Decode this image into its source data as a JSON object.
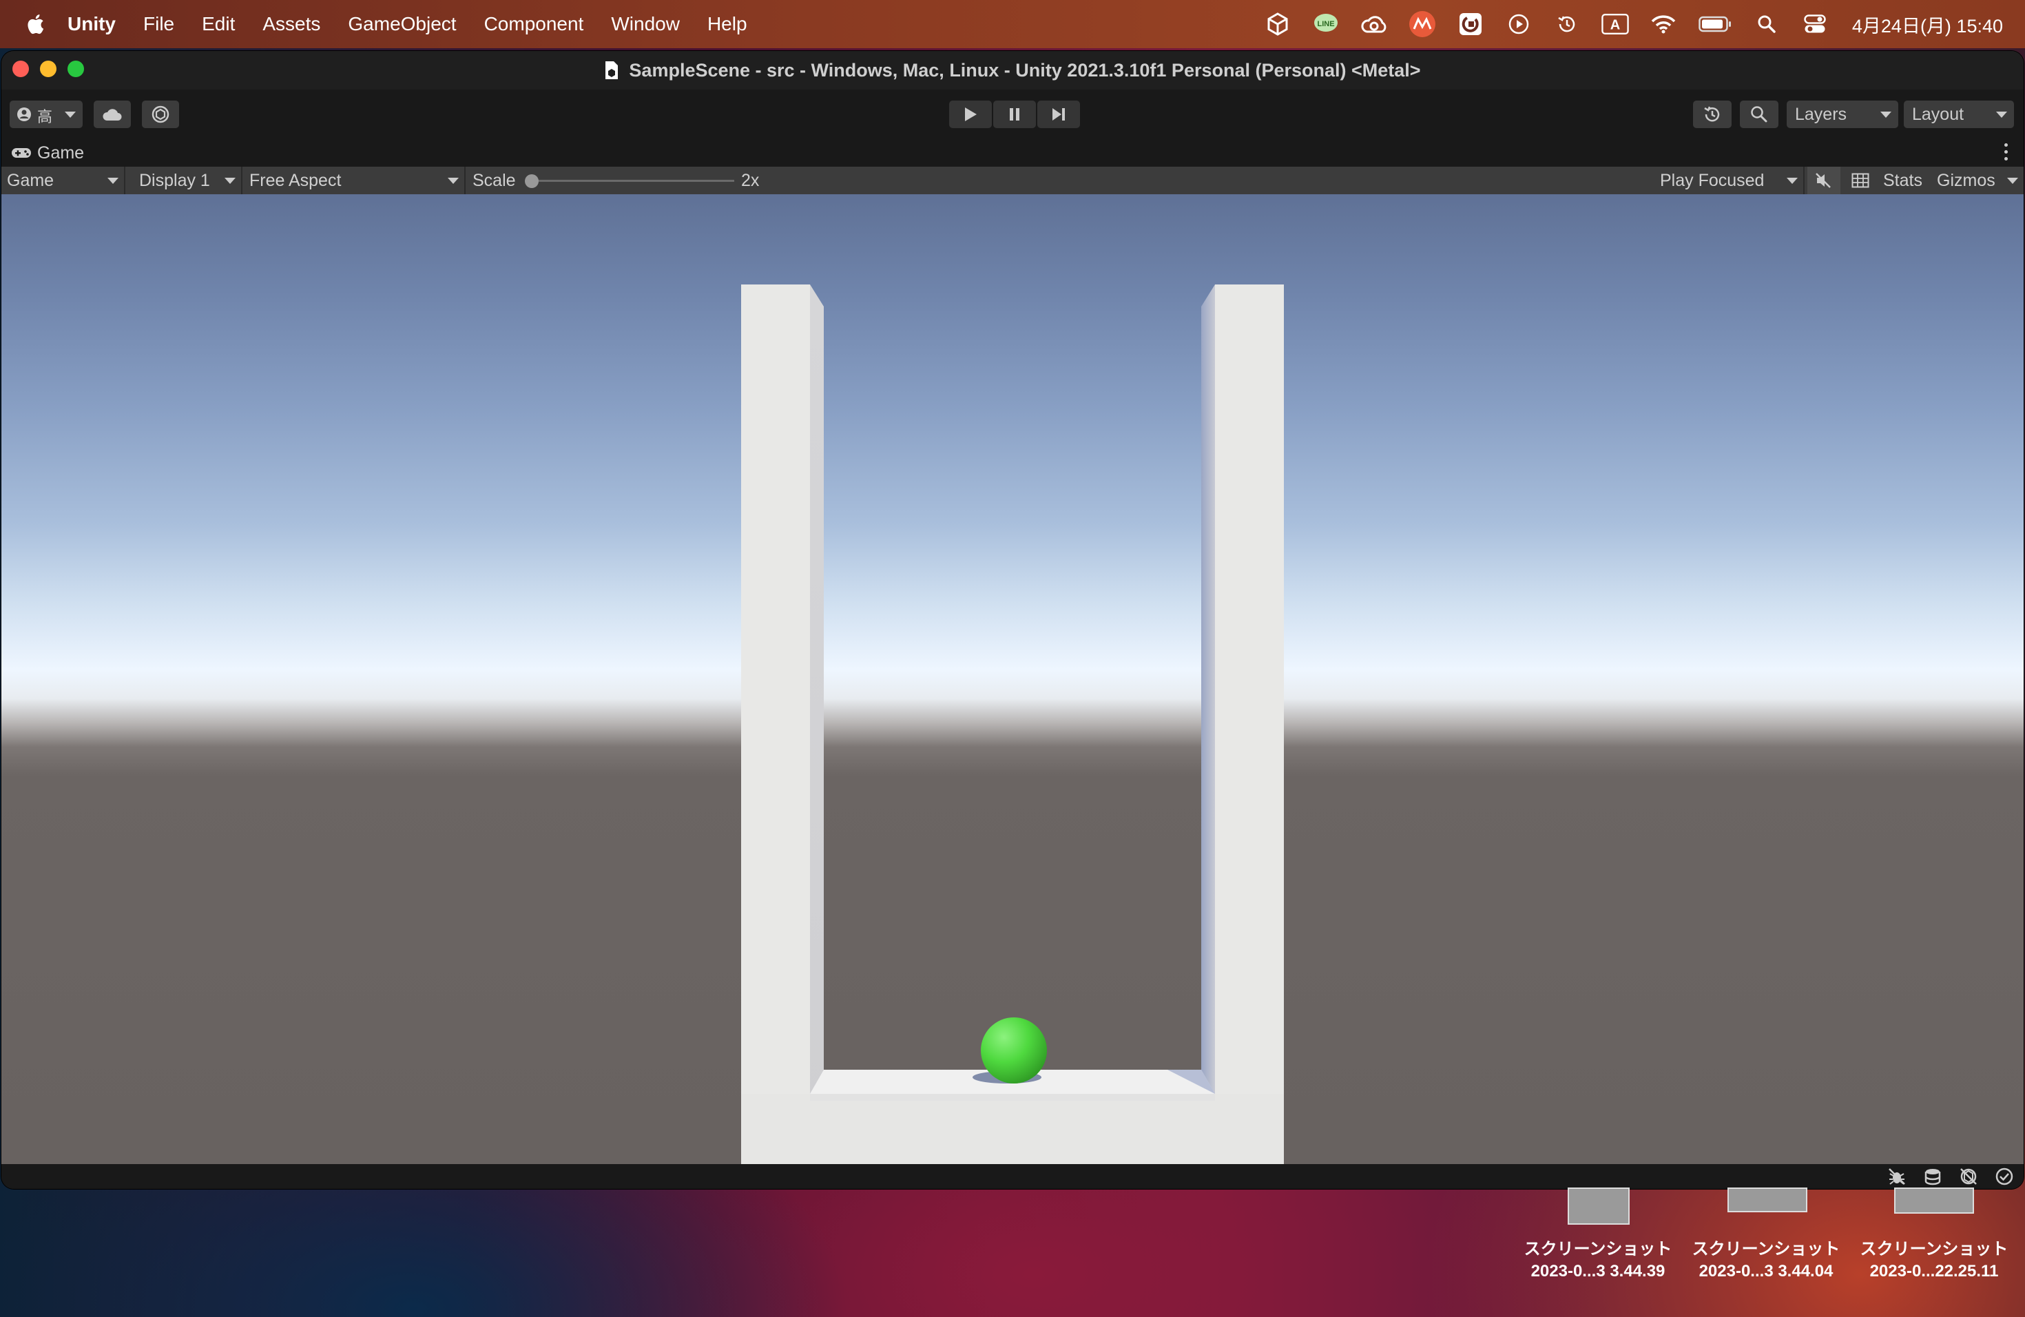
{
  "menubar": {
    "app_name": "Unity",
    "items": [
      "File",
      "Edit",
      "Assets",
      "GameObject",
      "Component",
      "Window",
      "Help"
    ],
    "status_icons": [
      "unity-hub-icon",
      "line-icon",
      "creative-cloud-icon",
      "app-icon",
      "screen-capture-icon",
      "play-circle-icon",
      "time-machine-icon",
      "input-source-icon",
      "wifi-icon",
      "battery-icon",
      "spotlight-search-icon",
      "control-center-icon"
    ],
    "input_source": "A",
    "clock": "4月24日(月)  15:40"
  },
  "window": {
    "title": "SampleScene - src - Windows, Mac, Linux - Unity 2021.3.10f1 Personal (Personal) <Metal>"
  },
  "toolbar": {
    "account_label": "高",
    "layers_label": "Layers",
    "layout_label": "Layout"
  },
  "game_tab": {
    "tab_label": "Game",
    "mode_label": "Game",
    "display_label": "Display 1",
    "aspect_label": "Free Aspect",
    "scale_label": "Scale",
    "scale_value": "2x",
    "scale_fraction": 0.0,
    "play_focused_label": "Play Focused",
    "stats_label": "Stats",
    "gizmos_label": "Gizmos"
  },
  "scene": {
    "ball_color": "#4fd93f",
    "wall_color": "#e8e8e6"
  },
  "desktop": {
    "items": [
      {
        "line1": "スクリーンショット",
        "line2": "2023-0...3 3.44.39"
      },
      {
        "line1": "スクリーンショット",
        "line2": "2023-0...3 3.44.04"
      },
      {
        "line1": "スクリーンショット",
        "line2": "2023-0...22.25.11"
      }
    ]
  }
}
